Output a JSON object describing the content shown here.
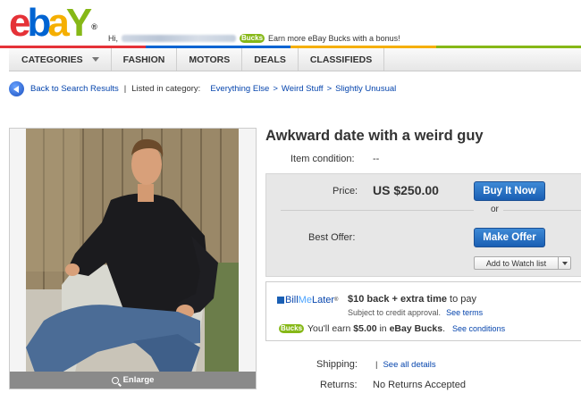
{
  "header": {
    "logo": {
      "e": "e",
      "b": "b",
      "a": "a",
      "y": "Y",
      "reg": "®"
    },
    "greeting_prefix": "Hi,",
    "bucks_badge": "Bucks",
    "promo_text": "Earn more eBay Bucks with a bonus!",
    "colorbar": [
      "#e53238",
      "#0064d2",
      "#f5af02",
      "#86b817"
    ]
  },
  "nav": {
    "items": [
      "CATEGORIES",
      "FASHION",
      "MOTORS",
      "DEALS",
      "CLASSIFIEDS"
    ]
  },
  "breadcrumb": {
    "back": "Back to Search Results",
    "listed": "Listed in category:",
    "path": [
      "Everything Else",
      "Weird Stuff",
      "Slightly Unusual"
    ],
    "sep": ">"
  },
  "photo": {
    "enlarge": "Enlarge"
  },
  "item": {
    "title": "Awkward date with a weird guy",
    "condition_label": "Item condition:",
    "condition_value": "--",
    "price_label": "Price:",
    "price_value": "US $250.00",
    "buy_now": "Buy It Now",
    "or": "or",
    "best_offer_label": "Best Offer:",
    "make_offer": "Make Offer",
    "watch_list": "Add to Watch list"
  },
  "promo": {
    "bml_bill": "Bill",
    "bml_me": "Me",
    "bml_later": "Later",
    "bml_reg": "®",
    "bml_main_bold": "$10 back + extra time",
    "bml_main_rest": " to pay",
    "bml_sub": "Subject to credit approval.",
    "bml_terms": "See terms",
    "bucks_badge": "Bucks",
    "bucks_prefix": "You'll earn ",
    "bucks_amount": "$5.00",
    "bucks_mid": " in ",
    "bucks_name": "eBay Bucks",
    "bucks_end": ".",
    "bucks_conditions": "See conditions"
  },
  "shipping": {
    "label": "Shipping:",
    "bar": "|",
    "details": "See all details"
  },
  "returns": {
    "label": "Returns:",
    "value": "No Returns Accepted"
  }
}
